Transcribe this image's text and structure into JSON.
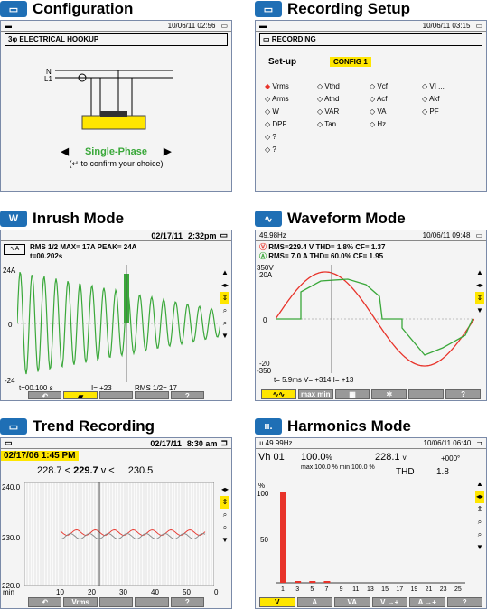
{
  "panels": {
    "config": {
      "title": "Configuration",
      "date": "10/06/11  02:56",
      "heading": "3φ ELECTRICAL HOOKUP",
      "wire_n": "N",
      "wire_l1": "L1",
      "choice": "Single-Phase",
      "confirm": "to confirm your choice)"
    },
    "recording": {
      "title": "Recording Setup",
      "date": "10/06/11  03:15",
      "heading": "RECORDING",
      "setup_label": "Set-up",
      "config": "CONFIG 1",
      "params": [
        [
          "Vrms",
          "Vthd",
          "Vcf",
          "VI ..."
        ],
        [
          "Arms",
          "Athd",
          "Acf",
          "Akf"
        ],
        [
          "W",
          "VAR",
          "VA",
          "PF"
        ],
        [
          "DPF",
          "Tan",
          "Hz",
          ""
        ],
        [
          "?",
          "",
          "",
          ""
        ],
        [
          "?",
          "",
          "",
          ""
        ]
      ]
    },
    "inrush": {
      "title": "Inrush Mode",
      "date": "02/17/11",
      "time": "2:32pm",
      "line1": "RMS 1/2 MAX=  17A      PEAK=  24A",
      "line2": "t=00.202s",
      "y_top": "24A",
      "y_zero": "0",
      "y_bot": "-24",
      "foot_t": "t=00.100 s",
      "foot_i": "I=  +23",
      "foot_rms": "RMS 1/2=  17",
      "btn_help": "?"
    },
    "waveform": {
      "title": "Waveform Mode",
      "freq": "49.98Hz",
      "date": "10/06/11  09:48",
      "v_line": "RMS=229.4 V    THD=  1.8%    CF= 1.37",
      "a_line": "RMS=    7.0 A    THD= 60.0%    CF= 1.95",
      "y_top_v": "350V",
      "y_top_a": "20A",
      "y_zero": "0",
      "y_bot_a": "-20",
      "y_bot_v": "-350",
      "foot": "t=  5.9ms  V=  +314    I=  +13",
      "btn_max": "max min",
      "btn_help": "?"
    },
    "trend": {
      "title": "Trend Recording",
      "date": "02/17/11",
      "time": "8:30 am",
      "start": "02/17/06   1:45 PM",
      "min_val": "228.7",
      "cur_val": "229.7",
      "unit": "v",
      "max_val": "230.5",
      "lt": "<",
      "y_top": "240.0",
      "y_mid": "230.0",
      "y_bot": "220.0",
      "x_ticks": [
        "10",
        "20",
        "30",
        "40",
        "50",
        "0"
      ],
      "x_unit": "min",
      "btn_vrms": "Vrms",
      "btn_help": "?"
    },
    "harmonics": {
      "title": "Harmonics Mode",
      "freq": "49.99Hz",
      "date": "10/06/11  06:40",
      "order": "Vh 01",
      "pct": "100.0",
      "pct_unit": "%",
      "volt": "228.1",
      "volt_unit": "v",
      "phase": "+000°",
      "maxmin": "max 100.0 %  min 100.0 %",
      "thd_label": "THD",
      "thd_val": "1.8",
      "y_unit": "%",
      "y_top": "100",
      "y_mid": "50",
      "x_ticks": [
        "1",
        "3",
        "5",
        "7",
        "9",
        "11",
        "13",
        "15",
        "17",
        "19",
        "21",
        "23",
        "25"
      ],
      "buttons": [
        "V",
        "A",
        "VA",
        "V →+",
        "A →+",
        "?"
      ],
      "chart_data": {
        "type": "bar",
        "categories": [
          "1",
          "3",
          "5",
          "7",
          "9",
          "11",
          "13",
          "15",
          "17",
          "19",
          "21",
          "23",
          "25"
        ],
        "values": [
          100,
          1.5,
          1.2,
          1.0,
          0,
          0,
          0,
          0,
          0,
          0,
          0,
          0,
          0
        ],
        "ylabel": "%",
        "ylim": [
          0,
          110
        ]
      }
    }
  },
  "colors": {
    "accent": "#1f6fb5",
    "highlight": "#ffe600",
    "green": "#3aa83a",
    "red": "#e8332a"
  }
}
